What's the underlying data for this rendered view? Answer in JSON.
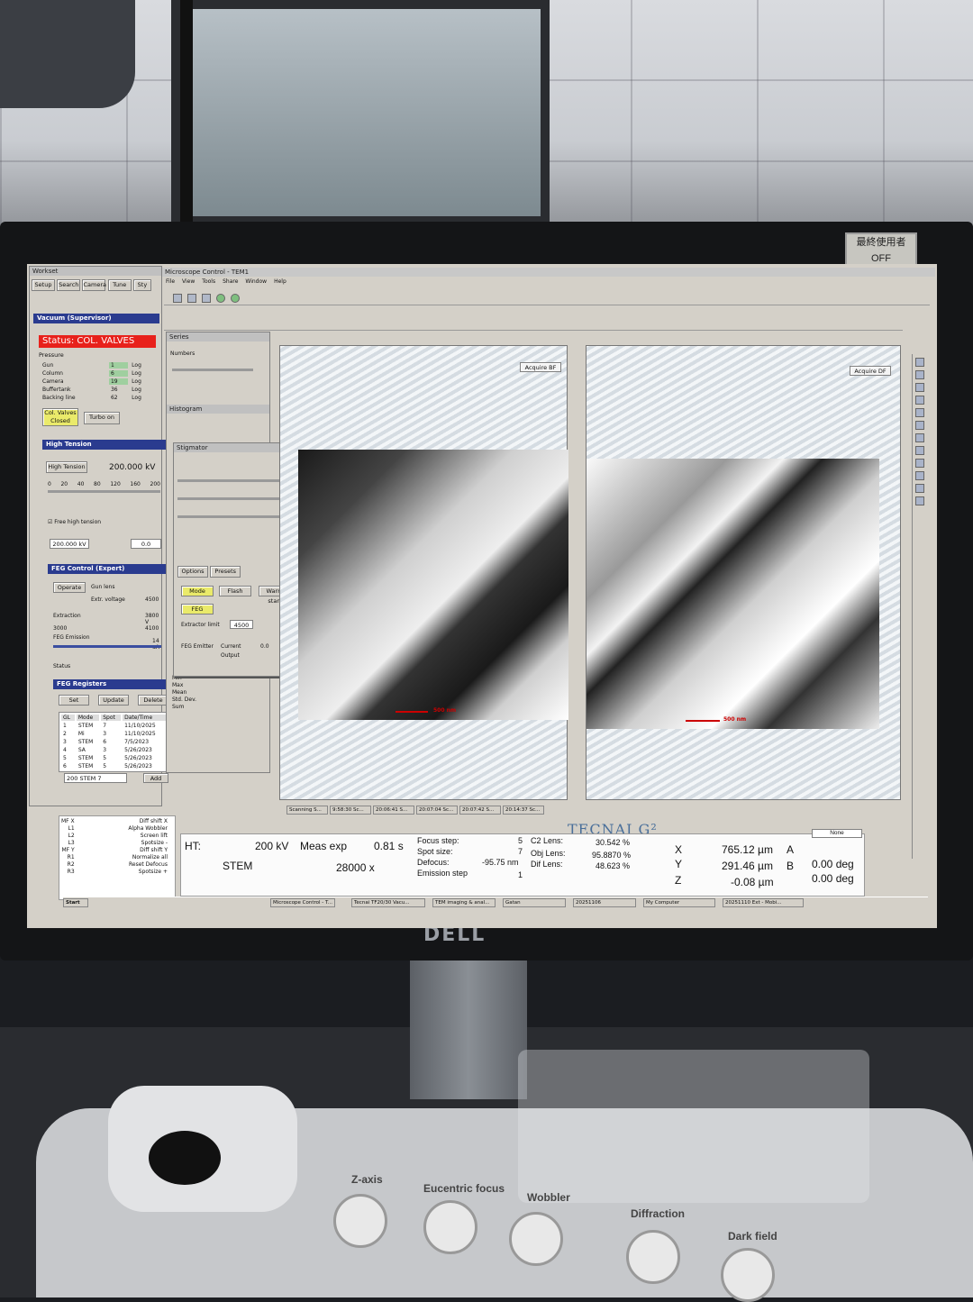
{
  "monitor": {
    "brand": "DELL",
    "sticker_line1": "最終使用者",
    "sticker_line2": "OFF"
  },
  "worksets": {
    "title": "Workset",
    "tabs": [
      "Setup",
      "Search",
      "Camera",
      "Tune",
      "Sty"
    ]
  },
  "vacuum": {
    "title": "Vacuum (Supervisor)",
    "status": "Status: COL. VALVES",
    "pressure_label": "Pressure",
    "rows": [
      {
        "name": "Gun",
        "value": "1",
        "unit": "Log"
      },
      {
        "name": "Column",
        "value": "6",
        "unit": "Log"
      },
      {
        "name": "Camera",
        "value": "19",
        "unit": "Log"
      },
      {
        "name": "Buffertank",
        "value": "36",
        "unit": "Log"
      },
      {
        "name": "Backing line",
        "value": "62",
        "unit": "Log"
      }
    ],
    "btn_col_valves": "Col. Valves Closed",
    "btn_turbo": "Turbo on"
  },
  "high_tension": {
    "title": "High Tension",
    "btn": "High Tension",
    "value": "200.000 kV",
    "scale": [
      "0",
      "20",
      "40",
      "80",
      "120",
      "160",
      "200"
    ],
    "free_ht_label": "Free high tension",
    "preset": "200.000 kV",
    "step": "0.0"
  },
  "stigmator": {
    "title": "Stigmator"
  },
  "ffg": {
    "title": "FEG Control (Expert)",
    "btn_operate": "Operate",
    "gun_lens_label": "Gun lens",
    "extr_voltage_label": "Extr. voltage",
    "extr_voltage_value": "4500",
    "extraction_label": "Extraction",
    "extraction_value": "3800 V",
    "emission_low": "3000",
    "emission_high": "4100",
    "feg_emission_label": "FEG Emission",
    "feg_emission_value": "14 uA",
    "status_label": "Status"
  },
  "options": {
    "tabs": [
      "Options",
      "Presets"
    ],
    "btn_mode": "Mode",
    "btn_flash": "Flash",
    "btn_warm_start": "Warm start",
    "btn_feg": "FEG",
    "extractor_label": "Extractor limit",
    "extractor_value": "4500",
    "feg_label": "FEG Emitter",
    "current_label": "Current",
    "current_value": "0.0",
    "output_label": "Output"
  },
  "registers": {
    "title": "FEG Registers",
    "buttons": [
      "Set",
      "Update",
      "Delete"
    ],
    "headers": [
      "GL",
      "Mode",
      "Spot",
      "Date/Time"
    ],
    "rows": [
      [
        "1",
        "STEM",
        "7",
        "11/10/2025"
      ],
      [
        "2",
        "Mi",
        "3",
        "11/10/2025"
      ],
      [
        "3",
        "STEM",
        "6",
        "7/5/2023"
      ],
      [
        "4",
        "SA",
        "3",
        "5/26/2023"
      ],
      [
        "5",
        "STEM",
        "5",
        "5/26/2023"
      ],
      [
        "6",
        "STEM",
        "5",
        "5/26/2023"
      ]
    ],
    "add_field": "200 STEM 7",
    "add_btn": "Add"
  },
  "series": {
    "title": "Series",
    "numbers_label": "Numbers"
  },
  "histogram": {
    "title": "Histogram",
    "rows": [
      "Min",
      "Max",
      "Mean",
      "Std. Dev.",
      "Sum"
    ]
  },
  "main_window": {
    "title": "Microscope Control - TEM1",
    "menu": [
      "File",
      "View",
      "Tools",
      "Share",
      "Window",
      "Help"
    ]
  },
  "images": {
    "left_label": "Acquire BF",
    "right_label": "Acquire DF",
    "scale_left": "500 nm",
    "scale_right": "500 nm",
    "tabs": [
      "Scanning S...",
      "9:58:30 Sc...",
      "20:06:41 S...",
      "20:07:04 Sc...",
      "20:07:42 S...",
      "20:14:37 Sc..."
    ]
  },
  "brand_overlay": "TECNAI G²",
  "readout": {
    "ht_label": "HT:",
    "ht_value": "200 kV",
    "meas_exp_label": "Meas exp",
    "meas_exp_value": "0.81 s",
    "mode": "STEM",
    "mag": "28000 x",
    "focus_step_label": "Focus step:",
    "focus_step": "5",
    "spot_size_label": "Spot size:",
    "spot_size": "7",
    "defocus_label": "Defocus:",
    "defocus": "-95.75 nm",
    "emission_step_label": "Emission step",
    "emission_step": "1",
    "c2_label": "C2 Lens:",
    "c2": "30.542 %",
    "obj_label": "Obj Lens:",
    "obj": "95.8870 %",
    "dif_label": "Dif Lens:",
    "dif": "48.623 %",
    "x_label": "X",
    "x": "765.12 µm",
    "y_label": "Y",
    "y": "291.46 µm",
    "z_label": "Z",
    "z": "-0.08 µm",
    "a_label": "A",
    "a": "0.00 deg",
    "b_label": "B",
    "b": "0.00 deg",
    "none_dropdown": "None"
  },
  "side_list": [
    "MF X",
    "L1",
    "L2",
    "L3",
    "MF Y",
    "R1",
    "R2",
    "R3"
  ],
  "side_list_right": [
    "Diff shift X",
    "Alpha Wobbler",
    "Screen lift",
    "Spotsize -",
    "Diff shift Y",
    "Normalize all",
    "Reset Defocus",
    "Spotsize +"
  ],
  "taskbar": {
    "start": "Start",
    "items": [
      "Microscope Control - T...",
      "Tecnai TF20/30 Vacu...",
      "TEM imaging & anal...",
      "Gatan",
      "20251106",
      "My Computer",
      "20251110 Ext - Mobi..."
    ]
  },
  "control_panel": {
    "labels": [
      "Z-axis",
      "Eucentric focus",
      "Wobbler",
      "Diffraction",
      "Dark field"
    ]
  }
}
